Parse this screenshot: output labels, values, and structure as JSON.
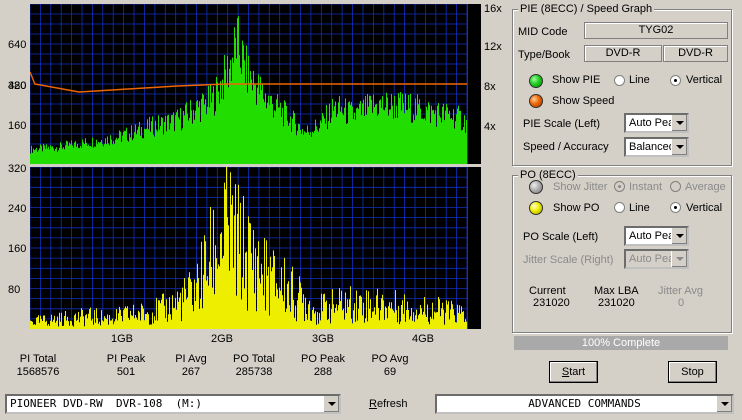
{
  "top_chart": {
    "left_ticks": [
      "640",
      "480",
      "320",
      "160"
    ],
    "right_ticks": [
      "16x",
      "12x",
      "8x",
      "4x"
    ]
  },
  "bottom_chart": {
    "left_ticks": [
      "320",
      "240",
      "160",
      "80"
    ]
  },
  "x_ticks": [
    "1GB",
    "2GB",
    "3GB",
    "4GB"
  ],
  "stats": [
    {
      "label": "PI Total",
      "value": "1568576"
    },
    {
      "label": "PI Peak",
      "value": "501"
    },
    {
      "label": "PI Avg",
      "value": "267"
    },
    {
      "label": "PO Total",
      "value": "285738"
    },
    {
      "label": "PO Peak",
      "value": "288"
    },
    {
      "label": "PO Avg",
      "value": "69"
    }
  ],
  "pie_group": {
    "title": "PIE (8ECC) / Speed Graph",
    "mid_label": "MID Code",
    "mid_value": "TYG02",
    "typebook_label": "Type/Book",
    "type_value": "DVD-R",
    "book_value": "DVD-R",
    "show_pie": "Show PIE",
    "show_speed": "Show Speed",
    "line": "Line",
    "vertical": "Vertical",
    "scale_label": "PIE Scale (Left)",
    "scale_value": "Auto Peak",
    "speed_label": "Speed / Accuracy",
    "speed_value": "Balanced",
    "pie_color": "#22cc22",
    "speed_color": "#ee6600"
  },
  "po_group": {
    "title": "PO (8ECC)",
    "show_jitter": "Show Jitter",
    "instant": "Instant",
    "average": "Average",
    "show_po": "Show PO",
    "line": "Line",
    "vertical": "Vertical",
    "scale_label": "PO Scale (Left)",
    "scale_value": "Auto Peak",
    "jitter_label": "Jitter Scale (Right)",
    "jitter_value": "Auto Peak",
    "current_label": "Current",
    "current_value": "231020",
    "maxlba_label": "Max LBA",
    "maxlba_value": "231020",
    "jitter_avg_label": "Jitter Avg",
    "jitter_avg_value": "0",
    "po_color": "#eeee00"
  },
  "progress": {
    "text": "100% Complete",
    "fraction": 1.0
  },
  "buttons": {
    "start": "Start",
    "stop": "Stop",
    "refresh": "Refresh",
    "refresh_u": "R",
    "refresh_rest": "efresh",
    "start_u": "S",
    "start_rest": "tart"
  },
  "drive_value": "PIONEER DVD-RW  DVR-108  (M:)",
  "advanced_value": "ADVANCED COMMANDS",
  "chart_data": [
    {
      "type": "area",
      "title": "",
      "x_unit": "GB",
      "xlim": [
        0,
        4.45
      ],
      "ylim": [
        0,
        640
      ],
      "y2lim": [
        0,
        16
      ],
      "x_ticks": [
        "1GB",
        "2GB",
        "3GB",
        "4GB"
      ],
      "y_ticks": [
        160,
        320,
        480,
        640
      ],
      "y2_ticks": [
        "4x",
        "8x",
        "12x",
        "16x"
      ],
      "series": [
        {
          "name": "PIE",
          "color": "#22dd00",
          "x": [
            0,
            0.3,
            0.6,
            0.9,
            1.2,
            1.5,
            1.7,
            1.85,
            1.95,
            2.05,
            2.1,
            2.2,
            2.3,
            2.4,
            2.6,
            2.8,
            2.95,
            3.1,
            3.3,
            3.5,
            3.7,
            3.9,
            4.1,
            4.3,
            4.45
          ],
          "values": [
            60,
            70,
            90,
            110,
            150,
            180,
            230,
            260,
            330,
            420,
            501,
            380,
            320,
            270,
            200,
            130,
            160,
            230,
            200,
            240,
            240,
            230,
            210,
            200,
            170
          ]
        },
        {
          "name": "Speed",
          "color": "#ee6600",
          "x": [
            0,
            0.05,
            0.5,
            1.0,
            1.5,
            2.0,
            2.5,
            3.0,
            3.5,
            4.0,
            4.45
          ],
          "values": [
            9.2,
            8.0,
            7.2,
            7.5,
            7.8,
            8.0,
            8.0,
            8.0,
            8.0,
            8.0,
            8.0
          ]
        }
      ]
    },
    {
      "type": "bar",
      "title": "",
      "xlim": [
        0,
        4.45
      ],
      "ylim": [
        0,
        320
      ],
      "y_ticks": [
        80,
        160,
        240,
        320
      ],
      "series": [
        {
          "name": "PO",
          "color": "#eeee00",
          "x": [
            0,
            0.2,
            0.4,
            0.6,
            0.8,
            1.0,
            1.2,
            1.4,
            1.6,
            1.7,
            1.8,
            1.9,
            2.0,
            2.1,
            2.2,
            2.3,
            2.4,
            2.5,
            2.6,
            2.7,
            2.8,
            2.9,
            3.0,
            3.2,
            3.4,
            3.6,
            3.8,
            4.0,
            4.2,
            4.45
          ],
          "values": [
            20,
            25,
            30,
            35,
            30,
            40,
            45,
            60,
            90,
            120,
            180,
            230,
            288,
            240,
            210,
            180,
            150,
            130,
            120,
            90,
            80,
            50,
            60,
            70,
            70,
            65,
            60,
            55,
            50,
            40
          ]
        }
      ]
    }
  ]
}
